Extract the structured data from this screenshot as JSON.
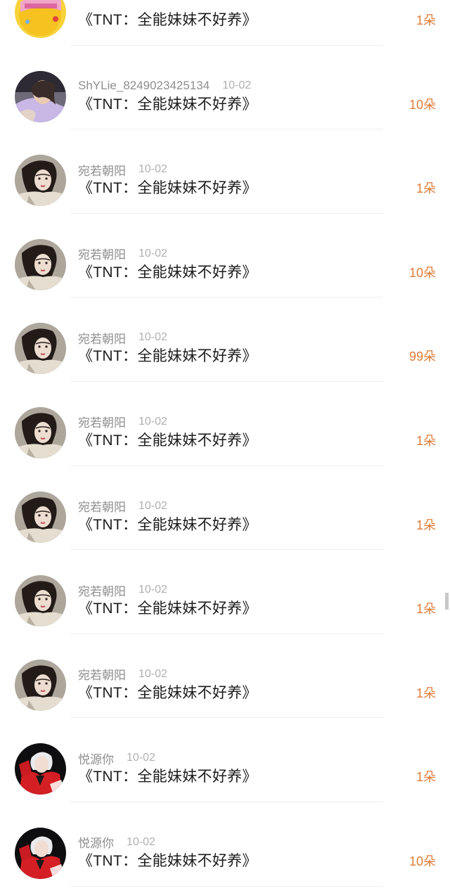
{
  "unit": "朵",
  "colors": {
    "accent": "#e07c36",
    "username": "#8e8e8e",
    "date": "#b0b0b0",
    "title": "#1c1c1c"
  },
  "records": [
    {
      "user": "",
      "date": "",
      "title": "《TNT：全能妹妹不好养》",
      "amount": "1朵",
      "avatar": "yellow-sticker-avatar"
    },
    {
      "user": "ShYLie_8249023425134",
      "date": "10-02",
      "title": "《TNT：全能妹妹不好养》",
      "amount": "10朵",
      "avatar": "photo-avatar"
    },
    {
      "user": "宛若朝阳",
      "date": "10-02",
      "title": "《TNT：全能妹妹不好养》",
      "amount": "1朵",
      "avatar": "portrait-avatar"
    },
    {
      "user": "宛若朝阳",
      "date": "10-02",
      "title": "《TNT：全能妹妹不好养》",
      "amount": "10朵",
      "avatar": "portrait-avatar"
    },
    {
      "user": "宛若朝阳",
      "date": "10-02",
      "title": "《TNT：全能妹妹不好养》",
      "amount": "99朵",
      "avatar": "portrait-avatar"
    },
    {
      "user": "宛若朝阳",
      "date": "10-02",
      "title": "《TNT：全能妹妹不好养》",
      "amount": "1朵",
      "avatar": "portrait-avatar"
    },
    {
      "user": "宛若朝阳",
      "date": "10-02",
      "title": "《TNT：全能妹妹不好养》",
      "amount": "1朵",
      "avatar": "portrait-avatar"
    },
    {
      "user": "宛若朝阳",
      "date": "10-02",
      "title": "《TNT：全能妹妹不好养》",
      "amount": "1朵",
      "avatar": "portrait-avatar"
    },
    {
      "user": "宛若朝阳",
      "date": "10-02",
      "title": "《TNT：全能妹妹不好养》",
      "amount": "1朵",
      "avatar": "portrait-avatar"
    },
    {
      "user": "悦源你",
      "date": "10-02",
      "title": "《TNT：全能妹妹不好养》",
      "amount": "1朵",
      "avatar": "red-jacket-avatar"
    },
    {
      "user": "悦源你",
      "date": "10-02",
      "title": "《TNT：全能妹妹不好养》",
      "amount": "10朵",
      "avatar": "red-jacket-avatar"
    }
  ]
}
